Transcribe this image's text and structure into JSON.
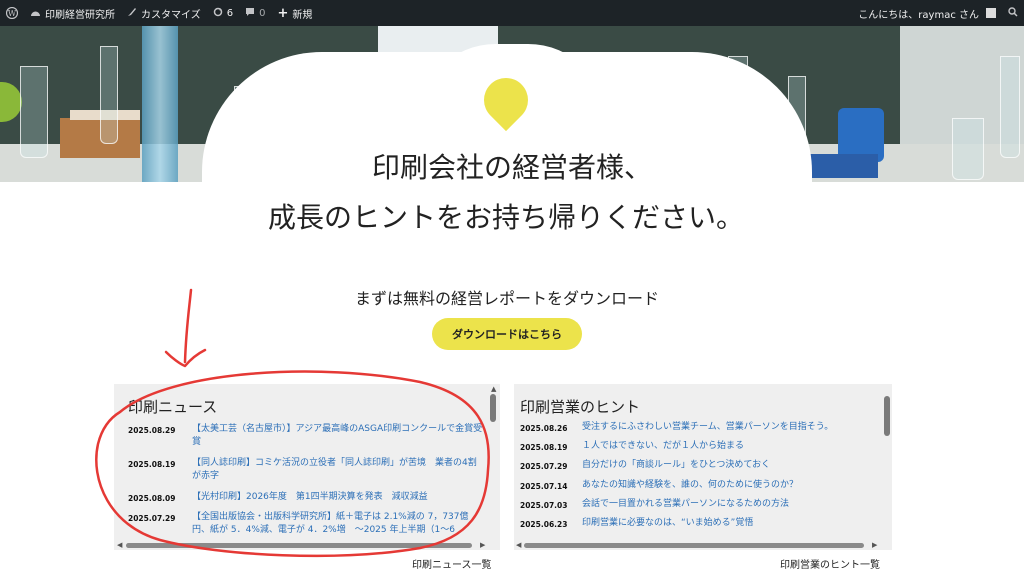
{
  "adminbar": {
    "site_name": "印刷経営研究所",
    "customize": "カスタマイズ",
    "updates": "6",
    "comments": "0",
    "new": "新規",
    "greeting": "こんにちは、raymac さん"
  },
  "hero": {
    "headline_line1": "印刷会社の経営者様、",
    "headline_line2": "成長のヒントをお持ち帰りください。",
    "accent_color": "#ece34b"
  },
  "cta": {
    "subheading": "まずは無料の経営レポートをダウンロード",
    "button_label": "ダウンロードはこちら"
  },
  "news_panel": {
    "title": "印刷ニュース",
    "items": [
      {
        "date": "2025.08.29",
        "text": "【太美工芸（名古屋市）】アジア最高峰のASGA印刷コンクールで金賞受賞"
      },
      {
        "date": "2025.08.19",
        "text": "【同人誌印刷】コミケ活況の立役者「同人誌印刷」が苦境　業者の4割が赤字"
      },
      {
        "date": "2025.08.09",
        "text": "【光村印刷】2026年度　第1四半期決算を発表　減収減益"
      },
      {
        "date": "2025.07.29",
        "text": "【全国出版協会・出版科学研究所】紙＋電子は 2.1%減の 7，737億円、紙が 5．4%減、電子が 4．2%増　～2025 年上半期（1～6"
      }
    ],
    "link": "印刷ニュース一覧"
  },
  "sales_panel": {
    "title": "印刷営業のヒント",
    "items": [
      {
        "date": "2025.08.26",
        "text": "受注するにふさわしい営業チーム、営業パーソンを目指そう。"
      },
      {
        "date": "2025.08.19",
        "text": "１人ではできない、だが１人から始まる"
      },
      {
        "date": "2025.07.29",
        "text": "自分だけの「商談ルール」をひとつ決めておく"
      },
      {
        "date": "2025.07.14",
        "text": "あなたの知識や経験を、誰の、何のために使うのか？"
      },
      {
        "date": "2025.07.03",
        "text": "会話で一目置かれる営業パーソンになるための方法"
      },
      {
        "date": "2025.06.23",
        "text": "印刷営業に必要なのは、“いま始める”覚悟"
      }
    ],
    "link": "印刷営業のヒント一覧"
  },
  "annotation_color": "#e53935"
}
